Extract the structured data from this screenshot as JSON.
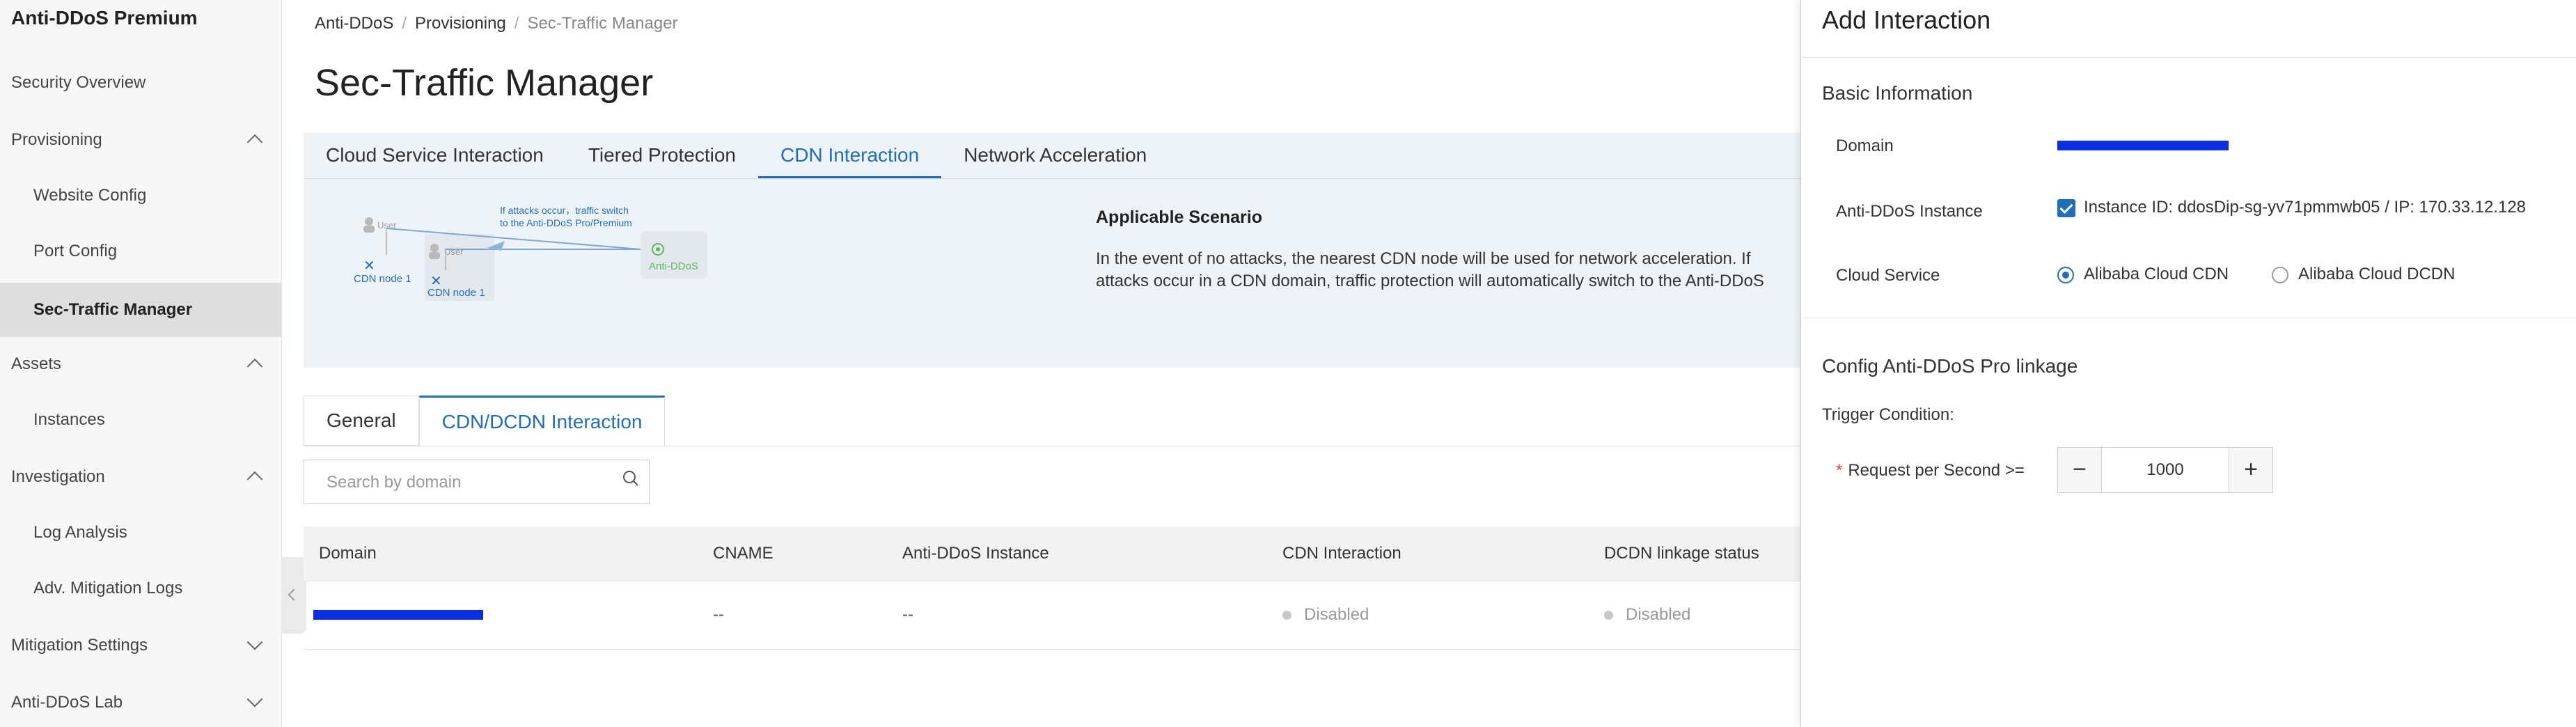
{
  "sidebar": {
    "title": "Anti-DDoS Premium",
    "items": [
      {
        "label": "Security Overview"
      },
      {
        "label": "Provisioning"
      },
      {
        "label": "Website Config"
      },
      {
        "label": "Port Config"
      },
      {
        "label": "Sec-Traffic Manager"
      },
      {
        "label": "Assets"
      },
      {
        "label": "Instances"
      },
      {
        "label": "Investigation"
      },
      {
        "label": "Log Analysis"
      },
      {
        "label": "Adv. Mitigation Logs"
      },
      {
        "label": "Mitigation Settings"
      },
      {
        "label": "Anti-DDoS Lab"
      }
    ]
  },
  "breadcrumb": [
    "Anti-DDoS",
    "Provisioning",
    "Sec-Traffic Manager"
  ],
  "page_title": "Sec-Traffic Manager",
  "tabs": [
    {
      "label": "Cloud Service Interaction"
    },
    {
      "label": "Tiered Protection"
    },
    {
      "label": "CDN Interaction"
    },
    {
      "label": "Network Acceleration"
    }
  ],
  "diagram": {
    "user_label": "User",
    "user_label_2": "User",
    "attack_note_line1": "If attacks occur，traffic switch",
    "attack_note_line2": "to the Anti-DDoS Pro/Premium",
    "node_1": "CDN node 1",
    "node_2": "CDN node 1",
    "anti_ddos": "Anti-DDoS"
  },
  "scenario": {
    "title": "Applicable Scenario",
    "text": "In the event of no attacks, the nearest CDN node will be used for network acceleration. If attacks occur in a CDN domain, traffic protection will automatically switch to the Anti-DDoS Pro/Premium"
  },
  "subtabs": [
    {
      "label": "General"
    },
    {
      "label": "CDN/DCDN Interaction"
    }
  ],
  "search": {
    "placeholder": "Search by domain"
  },
  "table": {
    "headers": [
      "Domain",
      "CNAME",
      "Anti-DDoS Instance",
      "CDN Interaction",
      "DCDN linkage status"
    ],
    "rows": [
      {
        "cname": "--",
        "instance": "--",
        "cdn": "Disabled",
        "dcdn": "Disabled"
      }
    ]
  },
  "drawer": {
    "title": "Add Interaction",
    "basic_title": "Basic Information",
    "domain_label": "Domain",
    "instance_label": "Anti-DDoS Instance",
    "instance_value": "Instance ID: ddosDip-sg-yv71pmmwb05 / IP: 170.33.12.128",
    "cloud_label": "Cloud Service",
    "cloud_opt1": "Alibaba Cloud CDN",
    "cloud_opt2": "Alibaba Cloud DCDN",
    "config_title": "Config Anti-DDoS Pro linkage",
    "trigger_label": "Trigger Condition:",
    "rps_label": "Request per Second >=",
    "rps_value": "1000",
    "required_mark": "*",
    "minus": "−",
    "plus": "+"
  },
  "colors": {
    "accent": "#1e6ebe",
    "redaction": "#0a2fe0"
  }
}
